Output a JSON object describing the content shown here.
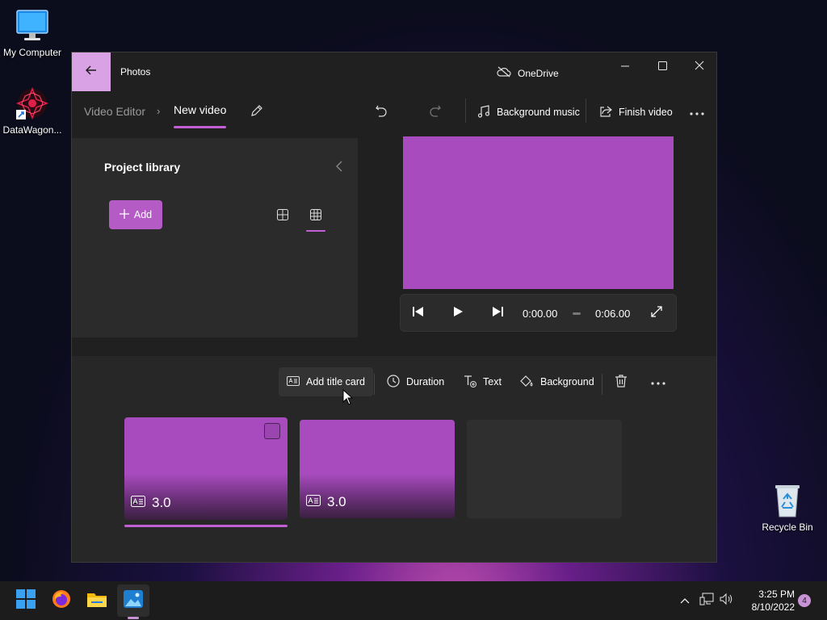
{
  "desktop": {
    "icons": [
      {
        "label": "My Computer"
      },
      {
        "label": "DataWagon..."
      },
      {
        "label": "Recycle Bin"
      }
    ]
  },
  "window": {
    "app_title": "Photos",
    "onedrive": "OneDrive",
    "breadcrumb": {
      "root": "Video Editor",
      "current": "New video"
    },
    "commands": {
      "background_music": "Background music",
      "finish_video": "Finish video"
    }
  },
  "library": {
    "title": "Project library",
    "add_label": "Add"
  },
  "player": {
    "current_time": "0:00.00",
    "total_time": "0:06.00"
  },
  "storyboard": {
    "toolbar": {
      "add_title_card": "Add title card",
      "duration": "Duration",
      "text": "Text",
      "background": "Background"
    },
    "clips": [
      {
        "duration": "3.0",
        "selected": true
      },
      {
        "duration": "3.0",
        "selected": false
      }
    ]
  },
  "taskbar": {
    "time": "3:25 PM",
    "date": "8/10/2022",
    "notifications": "4"
  },
  "colors": {
    "accent": "#c25fd6",
    "clip_fill": "#a84bbf",
    "back_button": "#d8a2e4"
  }
}
